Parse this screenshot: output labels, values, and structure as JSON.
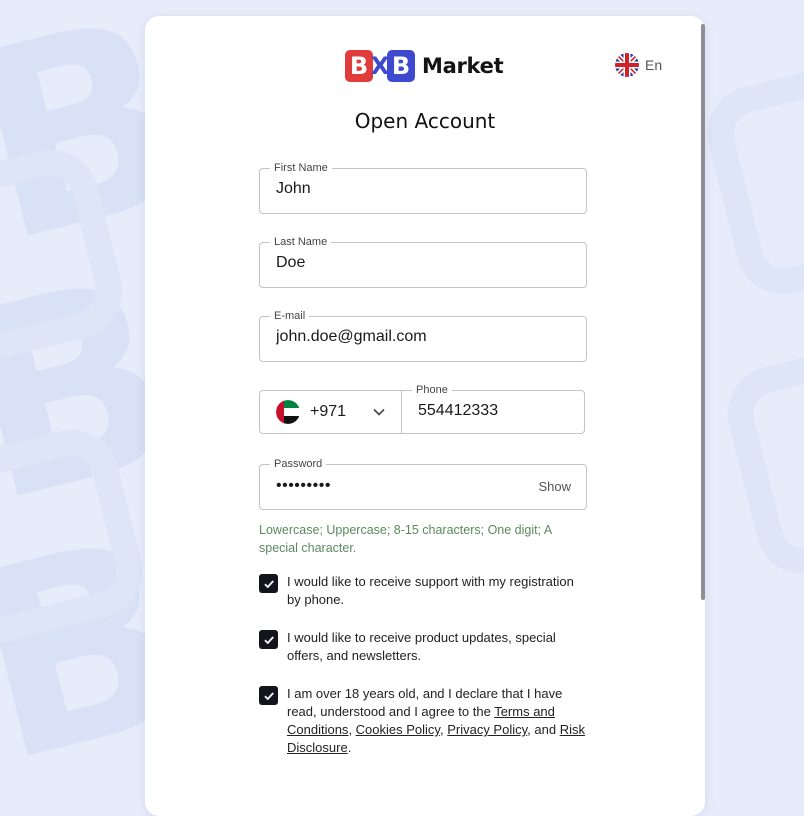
{
  "brand": {
    "logo_letter_1": "B",
    "logo_letter_2": "X",
    "logo_letter_3": "B",
    "logo_text": "Market",
    "color_red": "#e03c3c",
    "color_blue": "#3d49ce"
  },
  "language": {
    "label": "En",
    "icon": "uk-flag-icon"
  },
  "form": {
    "title": "Open Account",
    "first_name": {
      "label": "First Name",
      "value": "John"
    },
    "last_name": {
      "label": "Last Name",
      "value": "Doe"
    },
    "email": {
      "label": "E-mail",
      "value": "john.doe@gmail.com"
    },
    "phone": {
      "country_icon": "uae-flag-icon",
      "country_code": "+971",
      "label": "Phone",
      "value": "554412333"
    },
    "password": {
      "label": "Password",
      "masked_value": "•••••••••",
      "show_label": "Show"
    },
    "password_hint": "Lowercase; Uppercase; 8-15 characters; One digit; A special character.",
    "hint_color": "#5b8a5d",
    "consents": [
      {
        "checked": true,
        "text": "I would like to receive support with my registration by phone."
      },
      {
        "checked": true,
        "text": "I would like to receive product updates, special offers, and newsletters."
      },
      {
        "checked": true,
        "text_before": "I am over 18 years old, and I declare that I have read, understood and I agree to the ",
        "links": [
          "Terms and Conditions",
          "Cookies Policy",
          "Privacy Policy",
          "Risk Disclosure"
        ],
        "sep_1": ", ",
        "sep_2": ", ",
        "sep_3": ", and ",
        "end": "."
      }
    ]
  }
}
